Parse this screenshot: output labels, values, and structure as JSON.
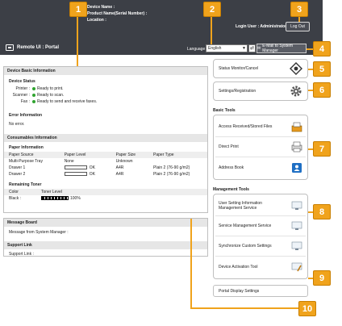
{
  "header": {
    "device_name": "Device Name :",
    "product_name": "Product Name(Serial Number) :",
    "location": "Location :",
    "login_user": "Login User :  Administrator",
    "logout": "Log Out"
  },
  "portal": {
    "title": "Remote UI : Portal",
    "language_label": "Language :",
    "language_value": "English",
    "email_button": "E-Mail to System Manager"
  },
  "device_info": {
    "title": "Device Basic Information",
    "status_title": "Device Status",
    "status": [
      {
        "label": "Printer :",
        "value": "Ready to print."
      },
      {
        "label": "Scanner :",
        "value": "Ready to scan."
      },
      {
        "label": "Fax :",
        "value": "Ready to send and receive faxes."
      }
    ],
    "error_title": "Error Information",
    "error_value": "No error."
  },
  "consumables": {
    "title": "Consumables Information",
    "paper_title": "Paper Information",
    "paper_headers": [
      "Paper Source",
      "Paper Level",
      "Paper Size",
      "Paper Type"
    ],
    "paper_rows": [
      {
        "source": "Multi-Purpose Tray",
        "level": "None",
        "size": "Unknown",
        "type": ""
      },
      {
        "source": "Drawer 1",
        "level": "OK",
        "size": "A4R",
        "type": "Plain 2 (76-90 g/m2)"
      },
      {
        "source": "Drawer 2",
        "level": "OK",
        "size": "A4R",
        "type": "Plain 2 (76-90 g/m2)"
      }
    ],
    "toner_title": "Remaining Toner",
    "toner_headers": [
      "Color",
      "Toner Level"
    ],
    "toner_rows": [
      {
        "color": "Black :",
        "level": "100%"
      }
    ]
  },
  "message_board": {
    "title": "Message Board",
    "text": "Message from System Manager :"
  },
  "support": {
    "title": "Support Link",
    "text": "Support Link :"
  },
  "right": {
    "status_monitor": "Status Monitor/Cancel",
    "settings": "Settings/Registration",
    "basic_tools_title": "Basic Tools",
    "basic_tools": [
      "Access Received/Stored Files",
      "Direct Print",
      "Address Book"
    ],
    "management_tools_title": "Management Tools",
    "management_tools": [
      "User Setting Information Management Service",
      "Service Management Service",
      "Synchronize Custom Settings",
      "Device Activation Tool"
    ],
    "portal_display": "Portal Display Settings"
  },
  "callouts": [
    "1",
    "2",
    "3",
    "4",
    "5",
    "6",
    "7",
    "8",
    "9",
    "10"
  ],
  "icons": {
    "portal": "portal-window-icon",
    "status_monitor": "status-monitor-icon",
    "settings": "gear-icon",
    "files": "tray-icon",
    "print": "printer-icon",
    "address": "address-book-icon",
    "management": "monitor-icon",
    "activation": "wrench-icon"
  },
  "colors": {
    "header_bg": "#3c3f46",
    "callout": "#f0a31c",
    "ready": "#2fa32f",
    "address_blue": "#1f6fc4"
  }
}
